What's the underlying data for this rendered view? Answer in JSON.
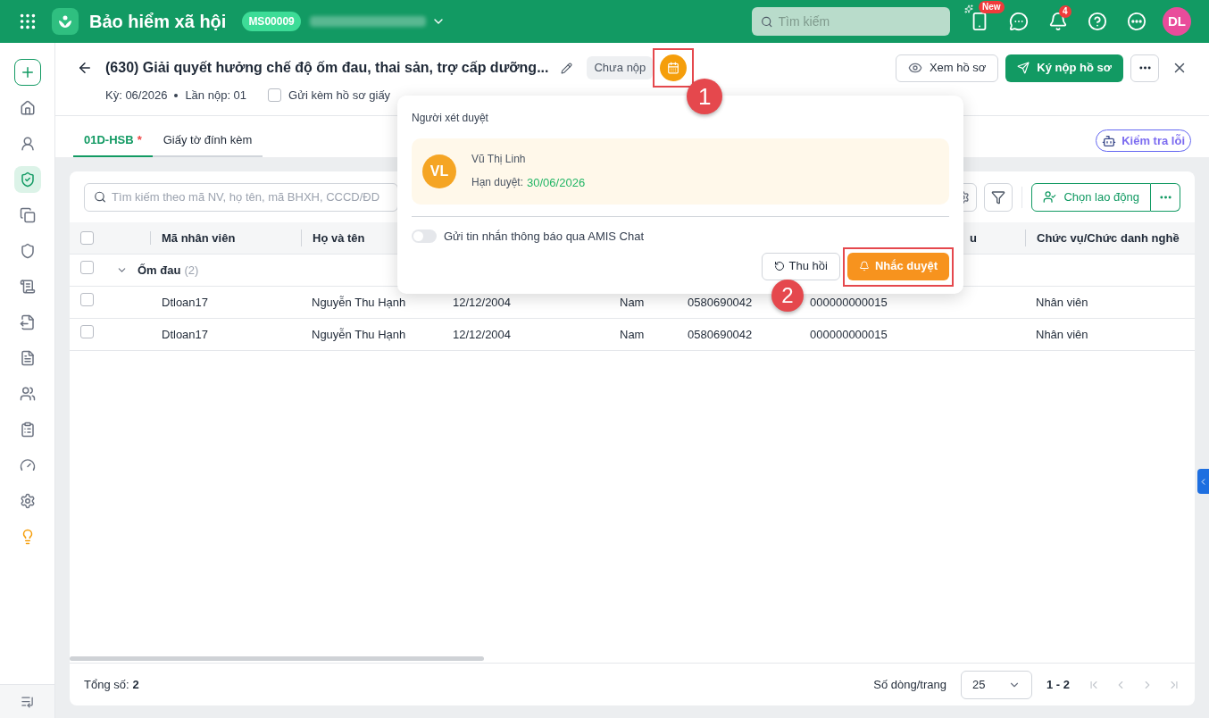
{
  "topbar": {
    "app_name": "Bảo hiểm xã hội",
    "company_code": "MS00009",
    "search": {
      "placeholder": "Tìm kiếm"
    },
    "new_badge": "New",
    "notification_count": "4",
    "avatar": "DL"
  },
  "sidebar": {
    "items": [
      {
        "selected": false
      },
      {
        "selected": false
      },
      {
        "selected": false
      },
      {
        "selected": true
      },
      {
        "selected": false
      },
      {
        "selected": false
      },
      {
        "selected": false
      },
      {
        "selected": false
      },
      {
        "selected": false
      },
      {
        "selected": false
      },
      {
        "selected": false
      },
      {
        "selected": false
      },
      {
        "selected": false
      },
      {
        "selected": false
      }
    ]
  },
  "header": {
    "title": "(630) Giải quyết hưởng chế độ ốm đau, thai sản, trợ cấp dưỡng...",
    "status": "Chưa nộp",
    "period": "Kỳ: 06/2026",
    "submission": "Lần nộp: 01",
    "attach_paper": {
      "label": "Gửi kèm hồ sơ giấy",
      "checked": false
    },
    "view_button": "Xem hồ sơ",
    "submit_button": "Ký nộp hồ sơ"
  },
  "tabs": [
    {
      "label": "01D-HSB",
      "required_mark": "*",
      "selected": true
    },
    {
      "label": "Giấy tờ đính kèm",
      "selected": false
    }
  ],
  "check_errors_button": "Kiểm tra lỗi",
  "table": {
    "all_checked": false,
    "search": {
      "placeholder": "Tìm kiếm theo mã NV, họ tên, mã BHXH, CCCD/ĐD"
    },
    "choose_button": "Chọn lao động",
    "columns": [
      {
        "label": "Mã nhân viên"
      },
      {
        "label": "Họ và tên"
      },
      {},
      {},
      {},
      {
        "label": "u"
      },
      {
        "label": "Chức vụ/Chức danh nghề"
      }
    ],
    "groups": [
      {
        "label": "Ốm đau",
        "count": "(2)",
        "expanded": true,
        "checked": false,
        "rows": [
          {
            "checked": false,
            "cells": [
              "Dtloan17",
              "Nguyễn Thu Hạnh",
              "12/12/2004",
              "Nam",
              "0580690042",
              "000000000015",
              "Nhân viên"
            ]
          },
          {
            "checked": false,
            "cells": [
              "Dtloan17",
              "Nguyễn Thu Hạnh",
              "12/12/2004",
              "Nam",
              "0580690042",
              "000000000015",
              "Nhân viên"
            ]
          }
        ]
      }
    ],
    "footer": {
      "total_label": "Tổng số:",
      "total": "2",
      "page_size_label": "Số dòng/trang",
      "page_size": "25",
      "range": "1 - 2"
    }
  },
  "popover": {
    "title": "Người xét duyệt",
    "approver": {
      "initials": "VL",
      "name": "Vũ Thị Linh",
      "deadline_label": "Hạn duyệt:",
      "deadline": "30/06/2026"
    },
    "notify": {
      "label": "Gửi tin nhắn thông báo qua AMIS Chat",
      "on": false
    },
    "revoke_button": "Thu hồi",
    "remind_button": "Nhắc duyệt"
  },
  "annotations": [
    {
      "label": "1"
    },
    {
      "label": "2"
    }
  ]
}
